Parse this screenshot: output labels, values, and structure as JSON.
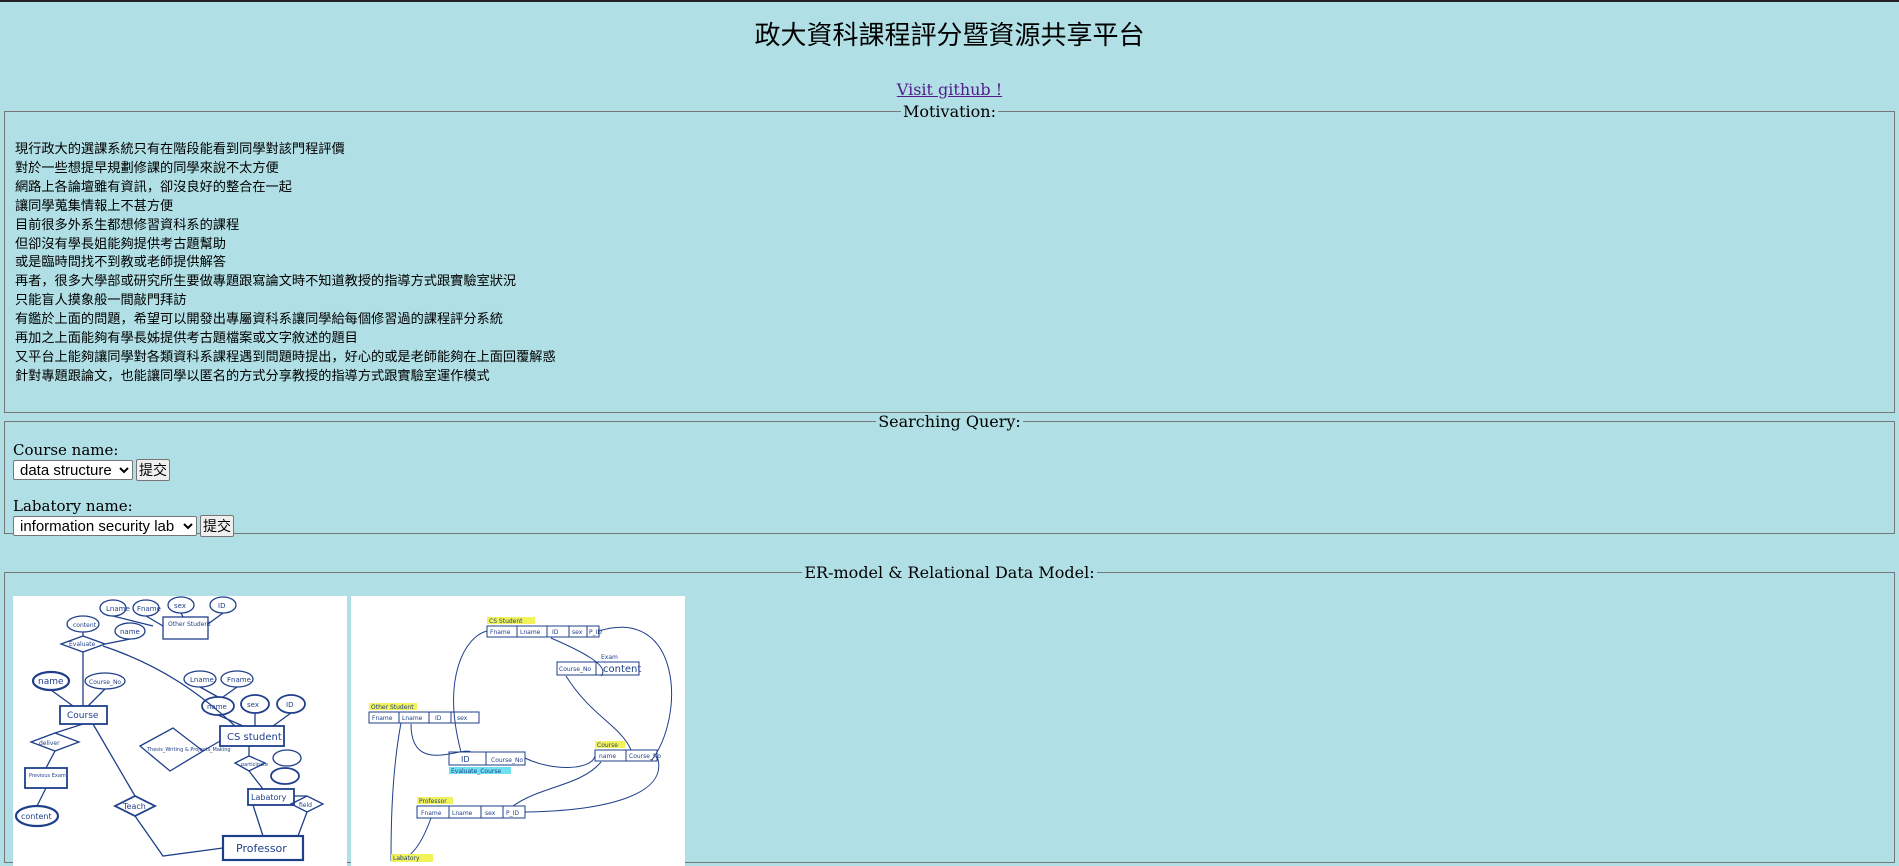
{
  "header": {
    "title": "政大資科課程評分暨資源共享平台",
    "github_link": "Visit github !"
  },
  "motivation": {
    "legend": "Motivation:",
    "lines": [
      "現行政大的選課系統只有在階段能看到同學對該門程評價",
      "對於一些想提早規劃修課的同學來說不太方便",
      "網路上各論壇雖有資訊，卻沒良好的整合在一起",
      "讓同學蒐集情報上不甚方便",
      "目前很多外系生都想修習資科系的課程",
      "但卻沒有學長姐能夠提供考古題幫助",
      "或是臨時問找不到教或老師提供解答",
      "再者，很多大學部或研究所生要做專題跟寫論文時不知道教授的指導方式跟實驗室狀況",
      "只能盲人摸象般一間敲門拜訪",
      "有鑑於上面的問題，希望可以開發出專屬資科系讓同學給每個修習過的課程評分系統",
      "再加之上面能夠有學長姊提供考古題檔案或文字敘述的題目",
      "又平台上能夠讓同學對各類資科系課程遇到問題時提出，好心的或是老師能夠在上面回覆解惑",
      "針對專題跟論文，也能讓同學以匿名的方式分享教授的指導方式跟實驗室運作模式"
    ]
  },
  "query": {
    "legend": "Searching Query:",
    "course_label": "Course name:",
    "course_selected": "data structure",
    "lab_label": "Labatory name:",
    "lab_selected": "information security lab",
    "submit_label": "提交"
  },
  "er_section": {
    "legend": "ER-model & Relational Data Model:",
    "er_labels": [
      "Lname",
      "Fname",
      "sex",
      "ID",
      "Other Student",
      "content",
      "name",
      "Evaluate",
      "name",
      "Course_No",
      "Lname",
      "Fname",
      "name",
      "sex",
      "ID",
      "Course",
      "CS student",
      "deliver",
      "Previous Exam",
      "Thesis_Writing & Projects_Making",
      "participate",
      "Labatory",
      "Teach",
      "content",
      "Professor",
      "field"
    ],
    "rel_labels": [
      "CS Student",
      "Fname",
      "Lname",
      "ID",
      "sex",
      "P_ID",
      "Course_No",
      "Exam",
      "content",
      "Other Student",
      "Fname",
      "Lname",
      "ID",
      "sex",
      "ID",
      "Course_No",
      "Evaluate_Course",
      "Course",
      "name",
      "Course_No",
      "Professor",
      "Fname",
      "Lname",
      "sex",
      "P_ID",
      "Labatory"
    ]
  }
}
